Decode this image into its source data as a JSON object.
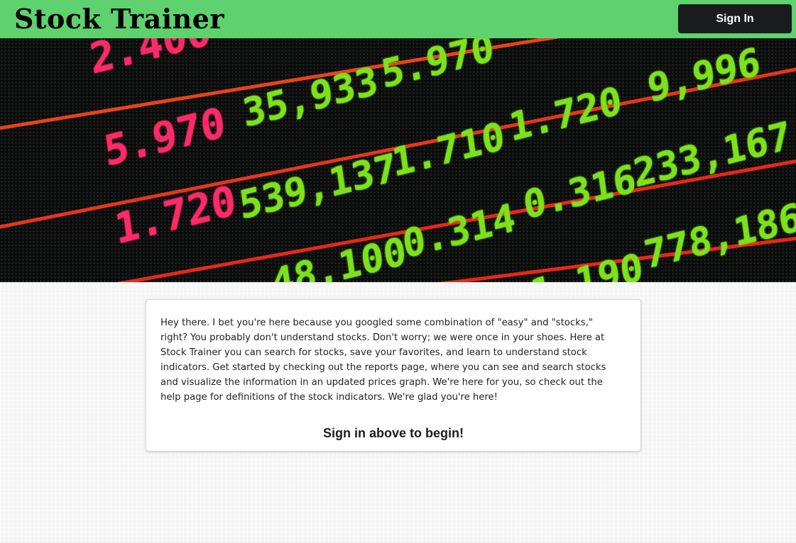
{
  "header": {
    "brand": "Stock Trainer",
    "signin_label": "Sign In",
    "background_color": "#5fd16f"
  },
  "hero": {
    "image": "stock-ticker-board",
    "red_values": [
      "2.400",
      "5.970",
      "1.720"
    ],
    "green_values": [
      "5.970",
      "9,996",
      "35,933",
      "1.720",
      "1.710",
      "233,167",
      "539,137",
      "0.316",
      "0.314",
      "778,186",
      "48,100",
      "1.190"
    ]
  },
  "intro": {
    "text": "Hey there. I bet you're here because you googled some combination of \"easy\" and \"stocks,\" right? You probably don't understand stocks. Don't worry; we were once in your shoes. Here at Stock Trainer you can search for stocks, save your favorites, and learn to understand stock indicators. Get started by checking out the reports page, where you can see and search stocks and visualize the information in an updated prices graph. We're here for you, so check out the help page for definitions of the stock indicators. We're glad you're here!",
    "cta": "Sign in above to begin!"
  }
}
